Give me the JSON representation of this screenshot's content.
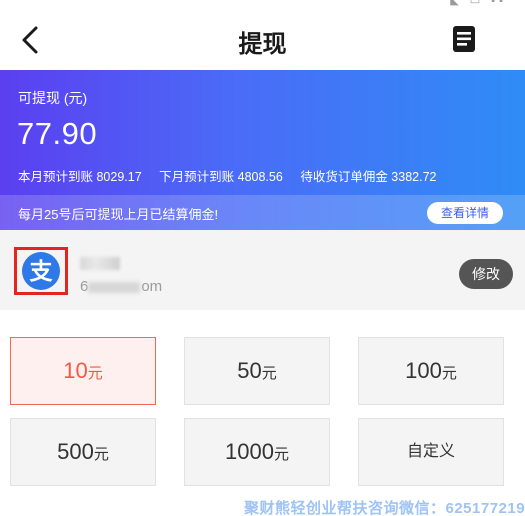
{
  "nav": {
    "title": "提现",
    "back_icon": "chevron-left-icon",
    "records_icon": "document-list-icon"
  },
  "balance": {
    "label": "可提现 (元)",
    "amount": "77.90",
    "stats": [
      "本月预计到账 8029.17",
      "下月预计到账 4808.56",
      "待收货订单佣金 3382.72"
    ],
    "notice": "每月25号后可提现上月已结算佣金!",
    "details_label": "查看详情",
    "gradient": [
      "#5b3ff0",
      "#2f8cf6"
    ]
  },
  "account": {
    "logo_text": "支",
    "logo_icon": "alipay-icon",
    "id_prefix": "6",
    "id_suffix": "om",
    "edit_label": "修改"
  },
  "amounts": {
    "unit": "元",
    "options": [
      "10",
      "50",
      "100",
      "500",
      "1000"
    ],
    "custom_label": "自定义",
    "selected_index": 0
  },
  "watermark": "聚财熊轻创业帮扶咨询微信：625177219",
  "colors": {
    "accent": "#ef5a45",
    "highlight_frame": "#e0261e",
    "alipay_blue": "#2f78e8"
  }
}
